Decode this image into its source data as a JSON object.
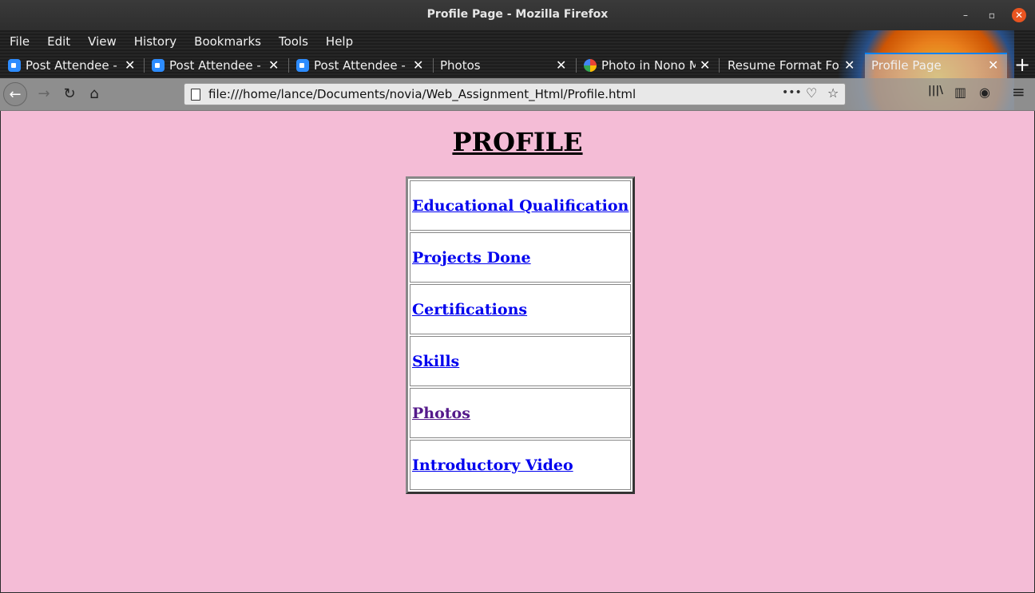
{
  "window": {
    "title": "Profile Page - Mozilla Firefox",
    "controls": {
      "minimize": "–",
      "maximize": "▫",
      "close": "✕"
    }
  },
  "menu": [
    "File",
    "Edit",
    "View",
    "History",
    "Bookmarks",
    "Tools",
    "Help"
  ],
  "tabs": [
    {
      "label": "Post Attendee - Zo",
      "icon": "zoom-icon",
      "active": false
    },
    {
      "label": "Post Attendee - Zo",
      "icon": "zoom-icon",
      "active": false
    },
    {
      "label": "Post Attendee - Zo",
      "icon": "zoom-icon",
      "active": false
    },
    {
      "label": "Photos",
      "icon": "",
      "active": false
    },
    {
      "label": "Photo in Nono Ma",
      "icon": "google-photos-icon",
      "active": false
    },
    {
      "label": "Resume Format For F",
      "icon": "",
      "active": false
    },
    {
      "label": "Profile Page",
      "icon": "",
      "active": true
    }
  ],
  "tab_close_glyph": "✕",
  "new_tab_glyph": "+",
  "navbar": {
    "back_glyph": "←",
    "forward_glyph": "→",
    "reload_glyph": "↻",
    "home_glyph": "⌂",
    "url": "file:///home/lance/Documents/novia/Web_Assignment_Html/Profile.html",
    "more_glyph": "•••",
    "pocket_glyph": "♡",
    "star_glyph": "☆",
    "library_glyph": "|||\\",
    "sidebar_glyph": "▥",
    "account_glyph": "◉",
    "menu_glyph": "≡"
  },
  "page": {
    "heading": "PROFILE",
    "links": [
      {
        "label": "Educational Qualification",
        "visited": false
      },
      {
        "label": "Projects Done",
        "visited": false
      },
      {
        "label": "Certifications",
        "visited": false
      },
      {
        "label": "Skills",
        "visited": false
      },
      {
        "label": "Photos",
        "visited": true
      },
      {
        "label": "Introductory Video",
        "visited": false
      }
    ]
  },
  "colors": {
    "page_background": "#f4bcd6",
    "link": "#0000ee",
    "visited_link": "#551a8b",
    "close_button": "#e95420"
  }
}
